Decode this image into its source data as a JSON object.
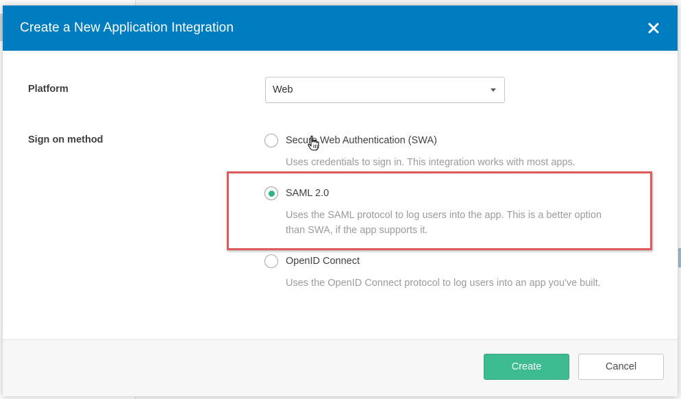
{
  "dialog": {
    "title": "Create a New Application Integration",
    "close_label": "×"
  },
  "platform": {
    "label": "Platform",
    "selected": "Web"
  },
  "sign_on": {
    "label": "Sign on method",
    "options": [
      {
        "label": "Secure Web Authentication (SWA)",
        "description": "Uses credentials to sign in. This integration works with most apps.",
        "checked": false
      },
      {
        "label": "SAML 2.0",
        "description_line1": "Uses the SAML protocol to log users into the app. This is a better option",
        "description_line2": "than SWA, if the app supports it.",
        "checked": true
      },
      {
        "label": "OpenID Connect",
        "description": "Uses the OpenID Connect protocol to log users into an app you've built.",
        "checked": false
      }
    ]
  },
  "footer": {
    "create_label": "Create",
    "cancel_label": "Cancel"
  },
  "colors": {
    "header": "#007dc1",
    "create": "#3dbb91",
    "highlight": "#e05a5a",
    "radio_selected": "#2eb67d"
  }
}
